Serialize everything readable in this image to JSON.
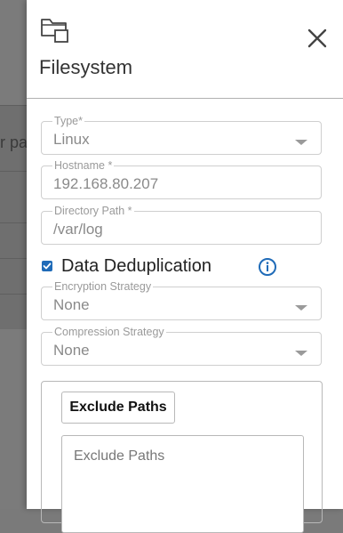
{
  "background": {
    "partial_text": "r pa"
  },
  "header": {
    "icon": "folder-icon",
    "title": "Filesystem",
    "close_icon": "close-icon"
  },
  "form": {
    "type": {
      "label": "Type*",
      "value": "Linux"
    },
    "hostname": {
      "label": "Hostname *",
      "value": "192.168.80.207"
    },
    "directory_path": {
      "label": "Directory Path *",
      "value": "/var/log"
    },
    "data_dedup": {
      "label": "Data Deduplication",
      "checked": true
    },
    "encryption": {
      "label": "Encryption Strategy",
      "value": "None"
    },
    "compression": {
      "label": "Compression Strategy",
      "value": "None"
    },
    "exclude_paths": {
      "button_label": "Exclude Paths",
      "placeholder": "Exclude Paths"
    }
  },
  "colors": {
    "accent": "#1f6bb8",
    "overlay": "#7b7b7b"
  }
}
